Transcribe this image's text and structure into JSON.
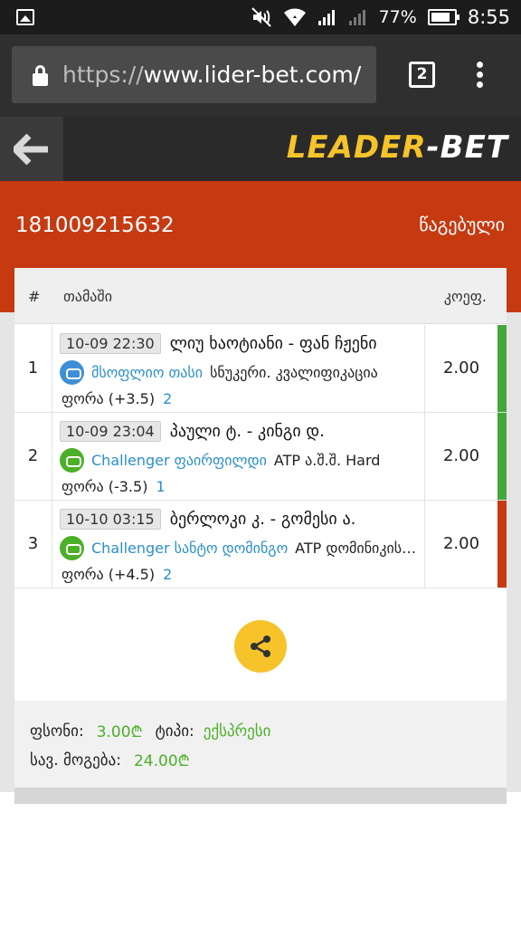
{
  "status_bar": {
    "icons": [
      "gallery-icon",
      "mute-icon",
      "wifi-icon",
      "signal-icon",
      "signal-weak-icon",
      "battery-icon"
    ],
    "battery": "77%",
    "time": "8:55"
  },
  "browser": {
    "url_scheme": "https://",
    "url_host": "www.lider-bet.com/",
    "tab_count": "2"
  },
  "header": {
    "logo_part1": "LEADER",
    "logo_part2": "-BET"
  },
  "bet": {
    "id": "181009215632",
    "status": "წაგებული"
  },
  "table": {
    "headers": {
      "num": "#",
      "game": "თამაში",
      "odds": "კოეფ."
    },
    "rows": [
      {
        "num": "1",
        "datetime": "10-09 22:30",
        "match": "ლიუ ხაოტიანი - ფან ჩჟენი",
        "league": "მსოფლიო თასი",
        "tournament": "სნუკერი. კვალიფიკაცია",
        "market": "ფორა (+3.5)",
        "pick": "2",
        "odds": "2.00",
        "status_color": "#43a73a",
        "icon": "snooker-icon"
      },
      {
        "num": "2",
        "datetime": "10-09 23:04",
        "match": "პაული ტ. - კინგი დ.",
        "league": "Challenger ფაირფილდი",
        "tournament": "ATP ა.შ.შ. Hard",
        "market": "ფორა (-3.5)",
        "pick": "1",
        "odds": "2.00",
        "status_color": "#43a73a",
        "icon": "tennis-icon"
      },
      {
        "num": "3",
        "datetime": "10-10 03:15",
        "match": "ბერლოკი კ. - გომესი ა.",
        "league": "Challenger სანტო დომინგო",
        "tournament": "ATP დომინიკის რესპუბლიკა",
        "market": "ფორა (+4.5)",
        "pick": "2",
        "odds": "2.00",
        "status_color": "#c63a12",
        "icon": "tennis-icon"
      }
    ]
  },
  "summary": {
    "stake_label": "ფსონი:",
    "stake_value": "3.00₾",
    "type_label": "ტიპი:",
    "type_value": "ექსპრესი",
    "win_label": "სავ. მოგება:",
    "win_value": "24.00₾"
  },
  "colors": {
    "accent_orange": "#c63a12",
    "brand_yellow": "#f6c32a",
    "link_blue": "#2a8fc9",
    "value_green": "#4caf28"
  }
}
